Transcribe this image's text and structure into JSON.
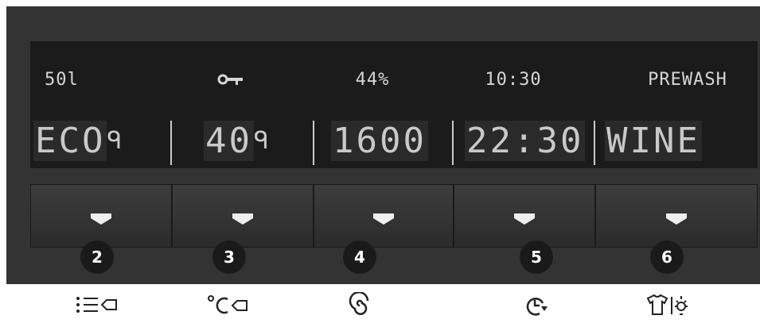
{
  "status": {
    "water": "50l",
    "lock": "lock-icon",
    "percent": "44%",
    "time": "10:30",
    "option": "PREWASH"
  },
  "display": {
    "program": "ECO",
    "temperature": "40",
    "spin": "1600",
    "delay": "22:30",
    "extra": "WINE"
  },
  "buttons": [
    "2",
    "3",
    "4",
    "5",
    "6"
  ],
  "icons": [
    "program-list-icon",
    "temperature-icon",
    "spin-icon",
    "delay-timer-icon",
    "shirt-light-icon"
  ],
  "colors": {
    "panel": "#333333",
    "display": "#1b1b1b",
    "segment": "#c9c9c9",
    "badge": "#1a1a1a"
  }
}
